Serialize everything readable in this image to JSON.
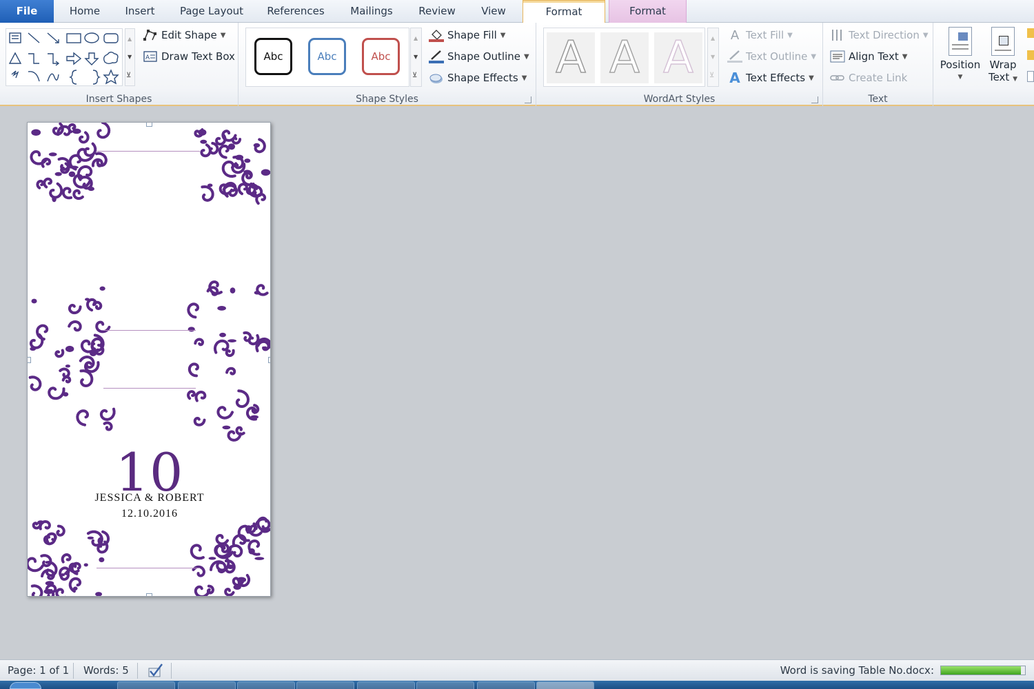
{
  "tabs": [
    {
      "label": "File"
    },
    {
      "label": "Home"
    },
    {
      "label": "Insert"
    },
    {
      "label": "Page Layout"
    },
    {
      "label": "References"
    },
    {
      "label": "Mailings"
    },
    {
      "label": "Review"
    },
    {
      "label": "View"
    },
    {
      "label": "Format"
    },
    {
      "label": "Format"
    }
  ],
  "ribbon": {
    "insert_shapes": {
      "edit_shape": "Edit Shape",
      "draw_text_box": "Draw Text Box",
      "label": "Insert Shapes"
    },
    "shape_styles": {
      "thumbnails": [
        "Abc",
        "Abc",
        "Abc"
      ],
      "thumbnail_colors": [
        "#111111",
        "#4a7ebb",
        "#c0504d"
      ],
      "shape_fill": "Shape Fill",
      "shape_outline": "Shape Outline",
      "shape_effects": "Shape Effects",
      "label": "Shape Styles"
    },
    "wordart_styles": {
      "glyph": "A",
      "text_fill": "Text Fill",
      "text_outline": "Text Outline",
      "text_effects": "Text Effects",
      "label": "WordArt Styles"
    },
    "text": {
      "text_direction": "Text Direction",
      "align_text": "Align Text",
      "create_link": "Create Link",
      "label": "Text"
    },
    "arrange": {
      "position": "Position",
      "wrap_line1": "Wrap",
      "wrap_line2": "Text"
    }
  },
  "document": {
    "table_number": "10",
    "names": "JESSICA & ROBERT",
    "date": "12.10.2016",
    "ornament_color": "#5b2a86"
  },
  "status": {
    "page": "Page: 1 of 1",
    "words": "Words: 5",
    "saving": "Word is saving Table No.docx:",
    "progress": 0.95
  }
}
